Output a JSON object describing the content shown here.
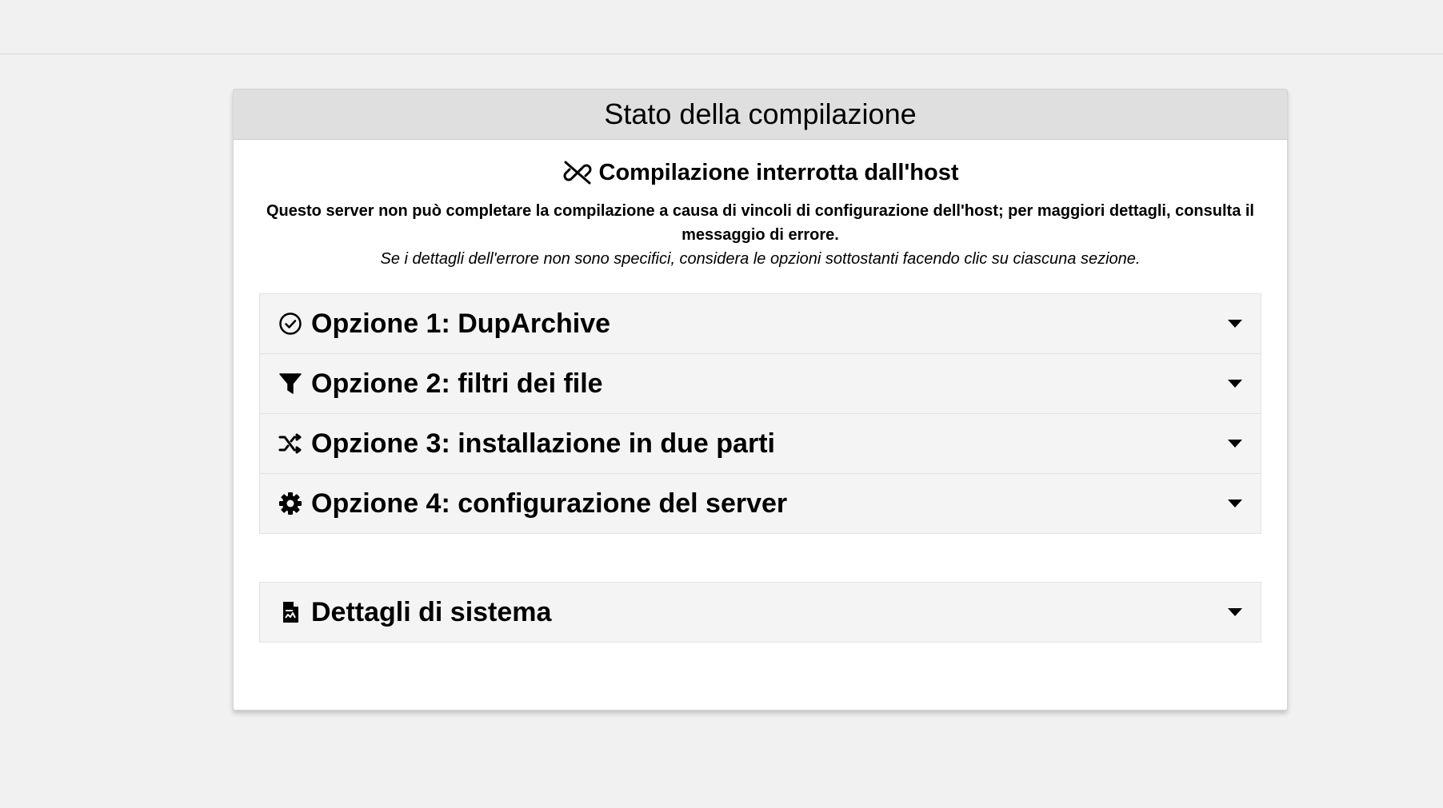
{
  "panel": {
    "title": "Stato della compilazione"
  },
  "status": {
    "icon": "broken-link-icon",
    "heading": "Compilazione interrotta dall'host",
    "description": "Questo server non può completare la compilazione a causa di vincoli di configurazione dell'host; per maggiori dettagli, consulta il messaggio di errore.",
    "hint": "Se i dettagli dell'errore non sono specifici, considera le opzioni sottostanti facendo clic su ciascuna sezione."
  },
  "options": [
    {
      "icon": "check-circle-icon",
      "label": "Opzione 1: DupArchive"
    },
    {
      "icon": "filter-icon",
      "label": "Opzione 2: filtri dei file"
    },
    {
      "icon": "shuffle-icon",
      "label": "Opzione 3: installazione in due parti"
    },
    {
      "icon": "gear-icon",
      "label": "Opzione 4: configurazione del server"
    }
  ],
  "system": {
    "icon": "file-report-icon",
    "label": "Dettagli di sistema"
  },
  "colors": {
    "background": "#f1f1f1",
    "panel_header": "#dfdfdf",
    "accordion_bg": "#f4f4f4",
    "text": "#000000"
  }
}
